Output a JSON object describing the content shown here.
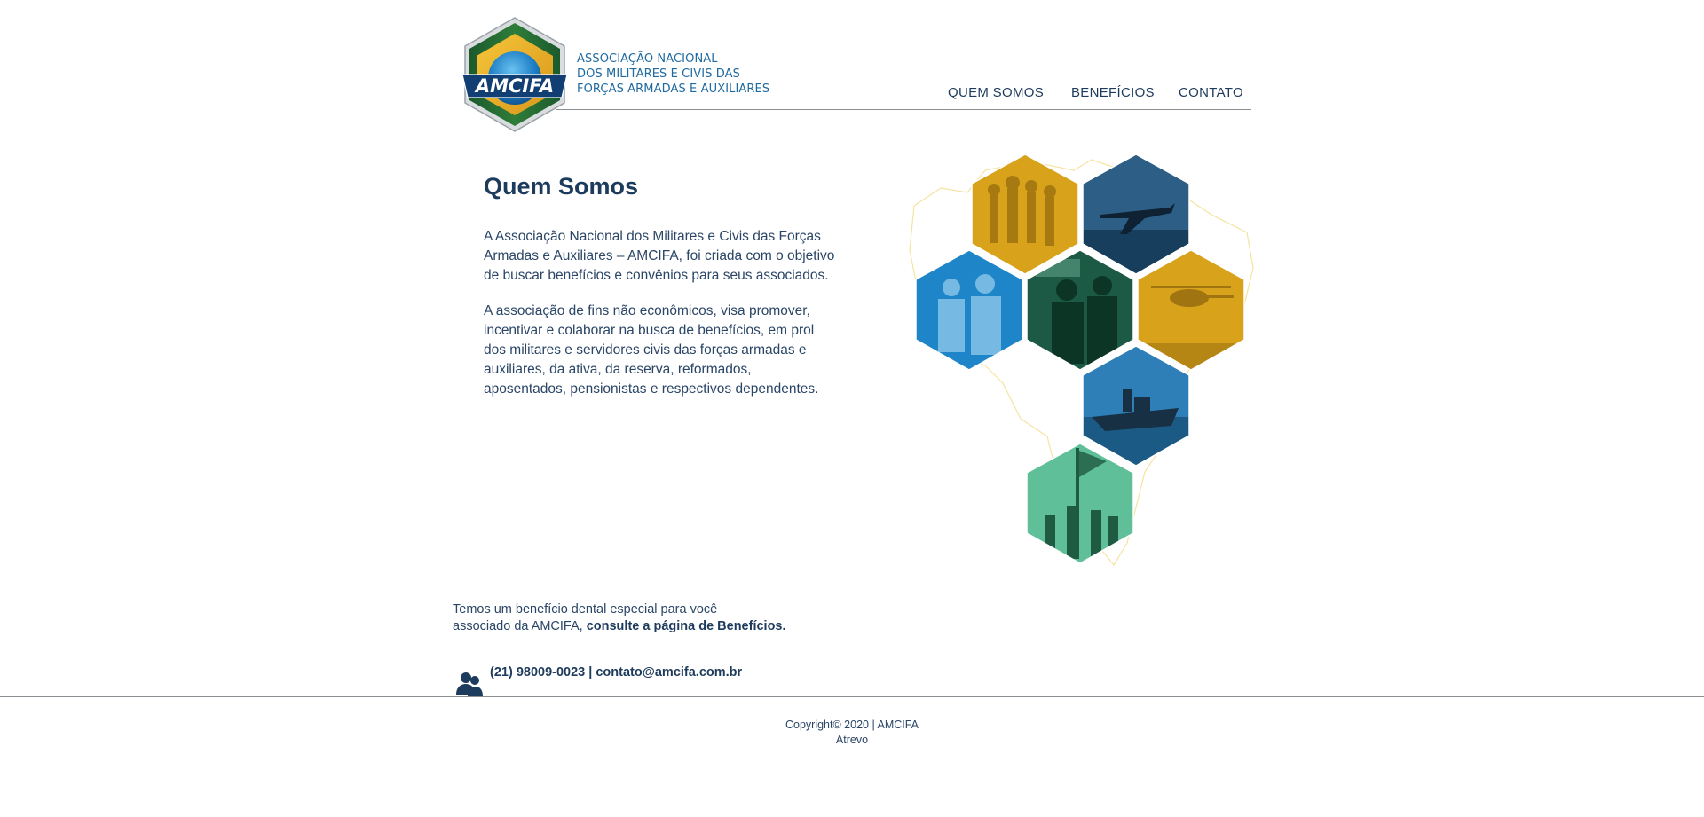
{
  "header": {
    "logo_text": "AMCIFA",
    "org_name_lines": [
      "ASSOCIAÇÃO NACIONAL",
      "DOS MILITARES E CIVIS DAS",
      "FORÇAS ARMADAS E AUXILIARES"
    ],
    "nav": [
      {
        "label": "QUEM SOMOS"
      },
      {
        "label": "BENEFÍCIOS"
      },
      {
        "label": "CONTATO"
      }
    ]
  },
  "main": {
    "title": "Quem Somos",
    "paragraph1_lines": [
      "A Associação Nacional dos Militares e Civis das Forças",
      "Armadas e Auxiliares – AMCIFA, foi criada com o objetivo",
      "de buscar benefícios e convênios para seus associados."
    ],
    "paragraph2_lines": [
      "A associação de fins não econômicos, visa promover,",
      "incentivar e colaborar na busca de benefícios, em prol",
      "dos militares e servidores civis das forças armadas e",
      "auxiliares, da ativa, da reserva, reformados,",
      "aposentados, pensionistas e respectivos dependentes."
    ]
  },
  "promo": {
    "line1": "Temos um benefício dental especial para você",
    "line2_prefix": "associado da AMCIFA, ",
    "link": "consulte a página de Benefícios."
  },
  "contact": {
    "phone": "(21) 98009-0023",
    "separator": " | ",
    "email": "contato@amcifa.com.br"
  },
  "footer": {
    "copyright": "Copyright© 2020 | AMCIFA",
    "credit": "Atrevo"
  },
  "colors": {
    "navy": "#1d3b5c",
    "brand_blue": "#1f6aa0",
    "gold": "#d9a21b",
    "steel_blue": "#2d5f86",
    "bright_blue": "#1e86c8",
    "dark_green": "#1d5a45",
    "mint": "#5fbf98",
    "rule": "#8a8f94"
  }
}
